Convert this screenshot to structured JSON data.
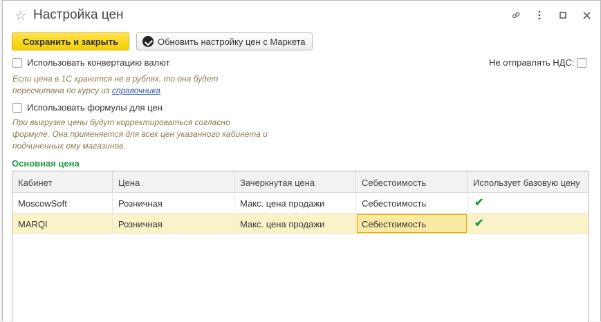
{
  "window": {
    "title": "Настройка цен",
    "icons": [
      "link-icon",
      "more-icon",
      "maximize-icon",
      "close-icon"
    ]
  },
  "toolbar": {
    "save_close_label": "Сохранить и закрыть",
    "refresh_label": "Обновить настройку цен с Маркета"
  },
  "options": {
    "currency_conversion_label": "Использовать конвертацию валют",
    "currency_hint_line1": "Если цена в 1С хранится не в рублях, то она будет",
    "currency_hint_line2_prefix": "пересчитана по курсу из ",
    "currency_hint_link": "справочника",
    "currency_hint_line2_suffix": ".",
    "no_vat_label": "Не отправлять НДС:",
    "formulas_label": "Использовать формулы для цен",
    "formulas_hint_line1": "При выгрузке цены будут корректироваться согласно",
    "formulas_hint_line2": "формуле. Она применяется для всех цен указанного кабинета и",
    "formulas_hint_line3": "подчиненных ему магазинов."
  },
  "section_title": "Основная цена",
  "table": {
    "columns": [
      "Кабинет",
      "Цена",
      "Зачеркнутая цена",
      "Себестоимость",
      "Использует базовую цену"
    ],
    "rows": [
      {
        "cabinet": "MoscowSoft",
        "price": "Розничная",
        "strike": "Макс. цена продажи",
        "cost": "Себестоимость",
        "uses_base": "✔"
      },
      {
        "cabinet": "MARQI",
        "price": "Розничная",
        "strike": "Макс. цена продажи",
        "cost": "Себестоимость",
        "uses_base": "✔"
      }
    ]
  },
  "colors": {
    "accent_yellow": "#f6cf00",
    "section_green": "#1e9a3f",
    "hint_text": "#8a7b53",
    "selected_row": "#fbf3c8"
  }
}
